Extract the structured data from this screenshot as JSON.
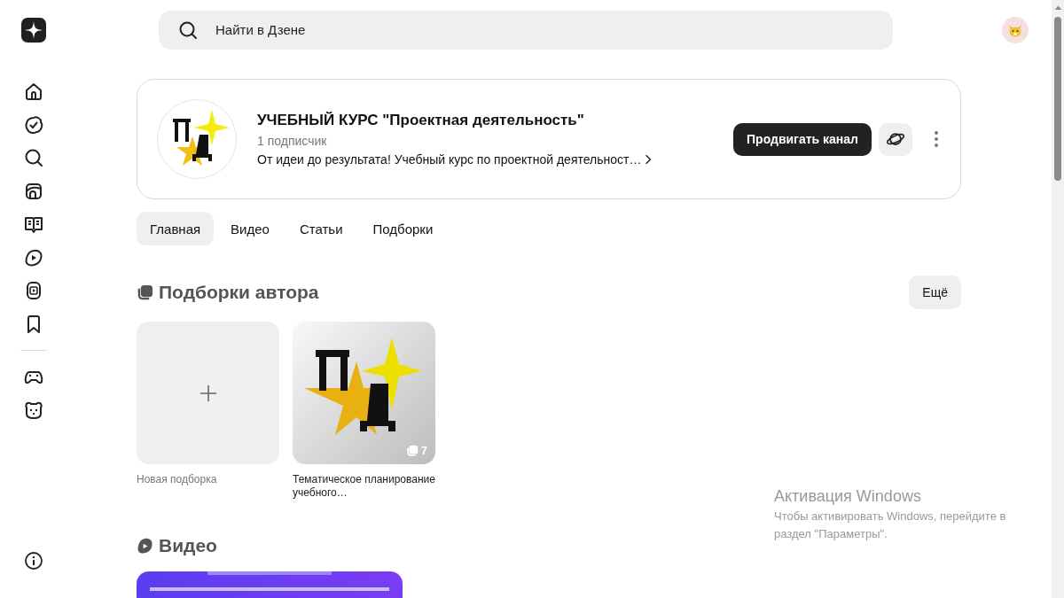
{
  "search": {
    "placeholder": "Найти в Дзене"
  },
  "channel": {
    "title": "УЧЕБНЫЙ КУРС \"Проектная деятельность\"",
    "subscribers": "1 подписчик",
    "description": "От идеи до результата! Учебный курс по проектной деятельност…",
    "promote_button": "Продвигать канал"
  },
  "tabs": [
    {
      "label": "Главная",
      "selected": true
    },
    {
      "label": "Видео",
      "selected": false
    },
    {
      "label": "Статьи",
      "selected": false
    },
    {
      "label": "Подборки",
      "selected": false
    }
  ],
  "collections": {
    "title": "Подборки автора",
    "more_button": "Ещё",
    "items": [
      {
        "kind": "new",
        "caption": "Новая подборка"
      },
      {
        "kind": "collection",
        "caption": "Тематическое планирование учебного…",
        "count": "7"
      }
    ]
  },
  "video": {
    "title": "Видео"
  },
  "windows_activation": {
    "title": "Активация Windows",
    "text": "Чтобы активировать Windows, перейдите в раздел \"Параметры\"."
  }
}
